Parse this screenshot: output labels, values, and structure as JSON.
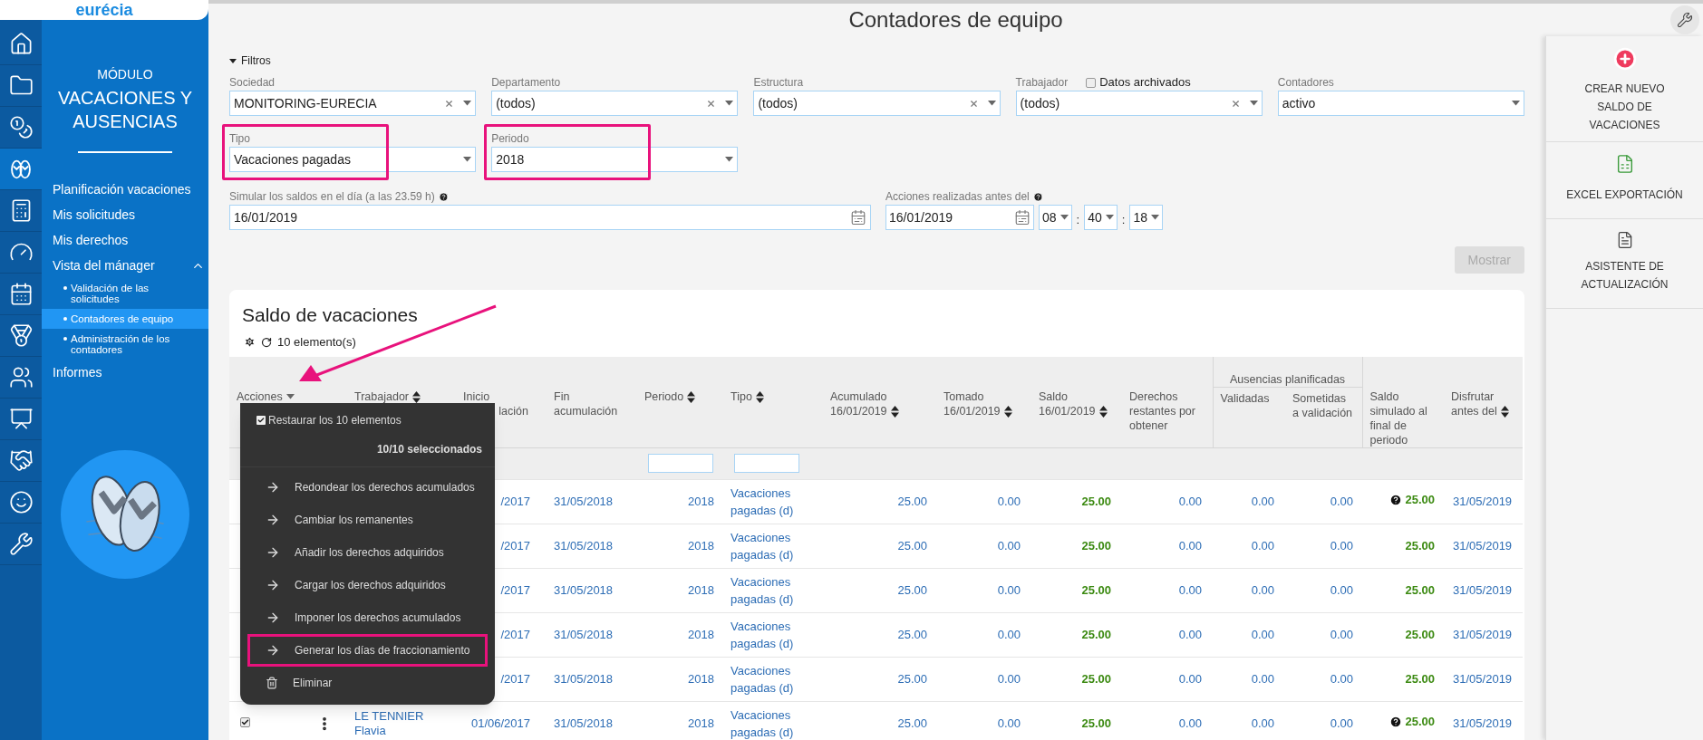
{
  "logo": "eurécia",
  "icon_rail": [
    {
      "kind": "home",
      "selected": false
    },
    {
      "kind": "folder",
      "selected": false
    },
    {
      "kind": "coins",
      "selected": false
    },
    {
      "kind": "sandals",
      "selected": true
    },
    {
      "kind": "calculator",
      "selected": false
    },
    {
      "kind": "gauge",
      "selected": false
    },
    {
      "kind": "calendar",
      "selected": false
    },
    {
      "kind": "medal",
      "selected": false
    },
    {
      "kind": "people",
      "selected": false
    },
    {
      "kind": "board",
      "selected": false
    },
    {
      "kind": "handshake",
      "selected": false
    },
    {
      "kind": "smile",
      "selected": false
    },
    {
      "kind": "wrench",
      "selected": false
    }
  ],
  "module": {
    "caption": "MÓDULO",
    "title": "VACACIONES Y AUSENCIAS"
  },
  "sidebar": {
    "items": [
      {
        "label": "Planificación vacaciones",
        "selected": false
      },
      {
        "label": "Mis solicitudes",
        "selected": false
      },
      {
        "label": "Mis derechos",
        "selected": false
      },
      {
        "label": "Vista del mánager",
        "selected": false,
        "expanded": true,
        "children": [
          {
            "label": "Validación de las solicitudes",
            "selected": false
          },
          {
            "label": "Contadores de equipo",
            "selected": true
          },
          {
            "label": "Administración de los contadores",
            "selected": false
          }
        ]
      },
      {
        "label": "Informes",
        "selected": false
      }
    ]
  },
  "page_title": "Contadores de equipo",
  "filters": {
    "toggle": "Filtros",
    "expanded": true,
    "fields": [
      {
        "label": "Sociedad",
        "value": "MONITORING-EURECIA",
        "clearable": true,
        "highlighted": false
      },
      {
        "label": "Departamento",
        "value": "(todos)",
        "clearable": true,
        "highlighted": false
      },
      {
        "label": "Estructura",
        "value": "(todos)",
        "clearable": true,
        "highlighted": false
      },
      {
        "label": "Trabajador",
        "value": "(todos)",
        "clearable": true,
        "highlighted": false,
        "checkbox": {
          "label": "Datos archivados",
          "checked": false
        }
      },
      {
        "label": "Contadores",
        "value": "activo",
        "clearable": false,
        "highlighted": false
      },
      {
        "label": "Tipo",
        "value": "Vacaciones pagadas",
        "clearable": false,
        "highlighted": true
      },
      {
        "label": "Periodo",
        "value": "2018",
        "clearable": false,
        "highlighted": true
      }
    ],
    "simulate": {
      "label": "Simular los saldos en el día (a las 23.59 h)",
      "value": "16/01/2019"
    },
    "actions_before": {
      "label": "Acciones realizadas antes del",
      "date": "16/01/2019",
      "hour": "08",
      "minute": "40",
      "second": "18",
      "separator": ":"
    },
    "submit": {
      "label": "Mostrar",
      "disabled": true
    }
  },
  "right_panel": [
    {
      "kind": "create",
      "label": "CREAR NUEVO SALDO DE VACACIONES"
    },
    {
      "kind": "excel",
      "label": "EXCEL EXPORTACIÓN"
    },
    {
      "kind": "assistant",
      "label": "ASISTENTE DE ACTUALIZACIÓN"
    }
  ],
  "table": {
    "title": "Saldo de vacaciones",
    "count": "10 elemento(s)",
    "columns": [
      {
        "label": "Acciones",
        "kind": "actions",
        "sortable": false
      },
      {
        "label": "Trabajador",
        "sortable": true
      },
      {
        "lines": [
          "Inicio",
          "lación"
        ],
        "sortable": false
      },
      {
        "label": "Fin acumulación",
        "sortable": false
      },
      {
        "label": "Periodo",
        "sortable": true,
        "filter": true
      },
      {
        "label": "Tipo",
        "sortable": true,
        "filter": true
      },
      {
        "label": "Acumulado 16/01/2019",
        "sortable": true
      },
      {
        "label": "Tomado 16/01/2019",
        "sortable": true
      },
      {
        "label": "Saldo 16/01/2019",
        "sortable": true
      },
      {
        "label": "Derechos restantes por obtener",
        "sortable": false
      },
      {
        "label": "Ausencias planificadas",
        "kind": "group",
        "children": [
          {
            "label": "Validadas",
            "sortable": false
          },
          {
            "label": "Sometidas a validación",
            "sortable": false
          }
        ]
      },
      {
        "label": "Saldo simulado al final de periodo",
        "sortable": false
      },
      {
        "label": "Disfrutar antes del",
        "sortable": true
      }
    ],
    "rows": [
      {
        "start": "/2017",
        "end": "31/05/2018",
        "period": "2018",
        "type": "Vacaciones pagadas (d)",
        "accrued": "25.00",
        "taken": "0.00",
        "balance": "25.00",
        "remaining": "0.00",
        "validated": "0.00",
        "submitted": "0.00",
        "simulated": "25.00",
        "help": true,
        "enjoy_before": "31/05/2019"
      },
      {
        "start": "/2017",
        "end": "31/05/2018",
        "period": "2018",
        "type": "Vacaciones pagadas (d)",
        "accrued": "25.00",
        "taken": "0.00",
        "balance": "25.00",
        "remaining": "0.00",
        "validated": "0.00",
        "submitted": "0.00",
        "simulated": "25.00",
        "help": false,
        "enjoy_before": "31/05/2019"
      },
      {
        "start": "/2017",
        "end": "31/05/2018",
        "period": "2018",
        "type": "Vacaciones pagadas (d)",
        "accrued": "25.00",
        "taken": "0.00",
        "balance": "25.00",
        "remaining": "0.00",
        "validated": "0.00",
        "submitted": "0.00",
        "simulated": "25.00",
        "help": false,
        "enjoy_before": "31/05/2019"
      },
      {
        "start": "/2017",
        "end": "31/05/2018",
        "period": "2018",
        "type": "Vacaciones pagadas (d)",
        "accrued": "25.00",
        "taken": "0.00",
        "balance": "25.00",
        "remaining": "0.00",
        "validated": "0.00",
        "submitted": "0.00",
        "simulated": "25.00",
        "help": false,
        "enjoy_before": "31/05/2019"
      },
      {
        "start": "/2017",
        "end": "31/05/2018",
        "period": "2018",
        "type": "Vacaciones pagadas (d)",
        "accrued": "25.00",
        "taken": "0.00",
        "balance": "25.00",
        "remaining": "0.00",
        "validated": "0.00",
        "submitted": "0.00",
        "simulated": "25.00",
        "help": false,
        "enjoy_before": "31/05/2019"
      },
      {
        "checked": true,
        "worker": "LE TENNIER Flavia",
        "start": "01/06/2017",
        "end": "31/05/2018",
        "period": "2018",
        "type": "Vacaciones pagadas (d)",
        "accrued": "25.00",
        "taken": "0.00",
        "balance": "25.00",
        "remaining": "0.00",
        "validated": "0.00",
        "submitted": "0.00",
        "simulated": "25.00",
        "help": true,
        "enjoy_before": "31/05/2019"
      }
    ]
  },
  "actions_menu": {
    "restore": {
      "label": "Restaurar los 10 elementos",
      "checked": true
    },
    "selected_count": "10/10 seleccionados",
    "items": [
      {
        "kind": "arrow",
        "label": "Redondear los derechos acumulados",
        "highlighted": false
      },
      {
        "kind": "arrow",
        "label": "Cambiar los remanentes",
        "highlighted": false
      },
      {
        "kind": "arrow",
        "label": "Añadir los derechos adquiridos",
        "highlighted": false
      },
      {
        "kind": "arrow",
        "label": "Cargar los derechos adquiridos",
        "highlighted": false
      },
      {
        "kind": "arrow",
        "label": "Imponer los derechos acumulados",
        "highlighted": false
      },
      {
        "kind": "arrow",
        "label": "Generar los días de fraccionamiento",
        "highlighted": true
      },
      {
        "kind": "trash",
        "label": "Eliminar",
        "highlighted": false
      }
    ]
  }
}
